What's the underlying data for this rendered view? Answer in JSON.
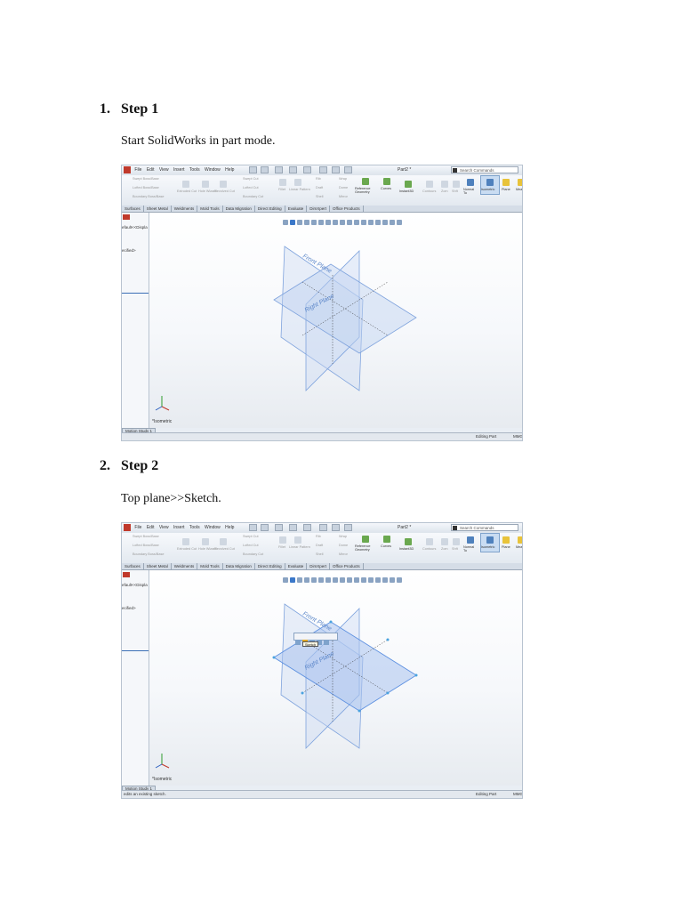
{
  "steps": [
    {
      "number": "1.",
      "title": "Step 1",
      "text": "Start SolidWorks in part mode.",
      "screenshot": {
        "menu": [
          "File",
          "Edit",
          "View",
          "Insert",
          "Tools",
          "Window",
          "Help"
        ],
        "doc_title": "Part2 *",
        "search_placeholder": "Search Commands",
        "ribbon": {
          "features": [
            "Swept Boss/Base",
            "Lofted Boss/Base",
            "Boundary Boss/Base",
            "Extruded Cut",
            "Hole Wizard",
            "Revolved Cut",
            "Swept Cut",
            "Lofted Cut",
            "Boundary Cut",
            "Fillet",
            "Linear Pattern",
            "Rib",
            "Draft",
            "Shell",
            "Wrap",
            "Dome",
            "Mirror"
          ],
          "reference_geometry": "Reference Geometry",
          "curves": "Curves",
          "instant3d": "Instant3D",
          "contours": "Contours",
          "zoom": "Zom",
          "shift": "Shft",
          "normal_to": "Normal To",
          "isometric": "Isometric",
          "plane": "Plane",
          "more": "Mea"
        },
        "tabs": [
          "Surfaces",
          "Sheet Metal",
          "Weldments",
          "Mold Tools",
          "Data Migration",
          "Direct Editing",
          "Evaluate",
          "DimXpert",
          "Office Products"
        ],
        "left_panel": [
          "efault<<Displa",
          "ecified>"
        ],
        "planes": {
          "front": "Front Plane",
          "right": "Right Plane"
        },
        "view_label": "*Isometric",
        "bottom_tab": "Motion Study 1",
        "status_left": "",
        "status_right": "Editing Part",
        "status_units": "MMG",
        "context_toolbar": false
      }
    },
    {
      "number": "2.",
      "title": "Step 2",
      "text": "Top plane>>Sketch.",
      "screenshot": {
        "menu": [
          "File",
          "Edit",
          "View",
          "Insert",
          "Tools",
          "Window",
          "Help"
        ],
        "doc_title": "Part2 *",
        "search_placeholder": "Search Commands",
        "ribbon": {
          "features": [
            "Swept Boss/Base",
            "Lofted Boss/Base",
            "Boundary Boss/Base",
            "Extruded Cut",
            "Hole Wizard",
            "Revolved Cut",
            "Swept Cut",
            "Lofted Cut",
            "Boundary Cut",
            "Fillet",
            "Linear Pattern",
            "Rib",
            "Draft",
            "Shell",
            "Wrap",
            "Dome",
            "Mirror"
          ],
          "reference_geometry": "Reference Geometry",
          "curves": "Curves",
          "instant3d": "Instant3D",
          "contours": "Contours",
          "zoom": "Zom",
          "shift": "Shft",
          "normal_to": "Normal To",
          "isometric": "Isometric",
          "plane": "Plane",
          "more": "Mea"
        },
        "tabs": [
          "Surfaces",
          "Sheet Metal",
          "Weldments",
          "Mold Tools",
          "Data Migration",
          "Direct Editing",
          "Evaluate",
          "DimXpert",
          "Office Products"
        ],
        "left_panel": [
          "efault<<Displa",
          "ecified>"
        ],
        "planes": {
          "front": "Front Plane",
          "right": "Right Plane"
        },
        "view_label": "*Isometric",
        "bottom_tab": "Motion Study 1",
        "status_left": "edits an existing sketch.",
        "status_right": "Editing Part",
        "status_units": "MMG",
        "context_toolbar": true,
        "tooltip": "Sketch"
      }
    }
  ]
}
